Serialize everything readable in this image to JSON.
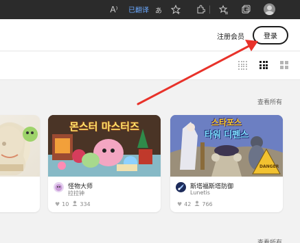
{
  "browser": {
    "reader_icon": "A⁾",
    "translate_label": "已翻译",
    "translate_icon": "あ",
    "icons": [
      "read-aloud-icon",
      "translate-icon",
      "favorite-add-icon",
      "extensions-icon",
      "favorites-icon",
      "collections-icon",
      "profile-avatar-icon"
    ]
  },
  "header": {
    "register_label": "注册会员",
    "login_label": "登录"
  },
  "sections": [
    {
      "see_all_label": "查看所有"
    },
    {
      "see_all_label": "查看所有"
    }
  ],
  "games": [
    {
      "title": "",
      "author": "",
      "likes": "",
      "plays": ""
    },
    {
      "title": "怪物大师",
      "thumb_title": "몬스터 마스터즈",
      "author": "拉拉钟",
      "likes": "10",
      "plays": "334"
    },
    {
      "title": "斯塔福斯塔防御",
      "thumb_title_line1": "스타포스",
      "thumb_title_line2": "타워 디펜스",
      "thumb_sign": "DANGER",
      "author": "Lunetis",
      "likes": "42",
      "plays": "766"
    }
  ],
  "colors": {
    "accent_arrow": "#e8322a",
    "browser_bar": "#2b2b2b",
    "translate_blue": "#6aa9ff"
  }
}
